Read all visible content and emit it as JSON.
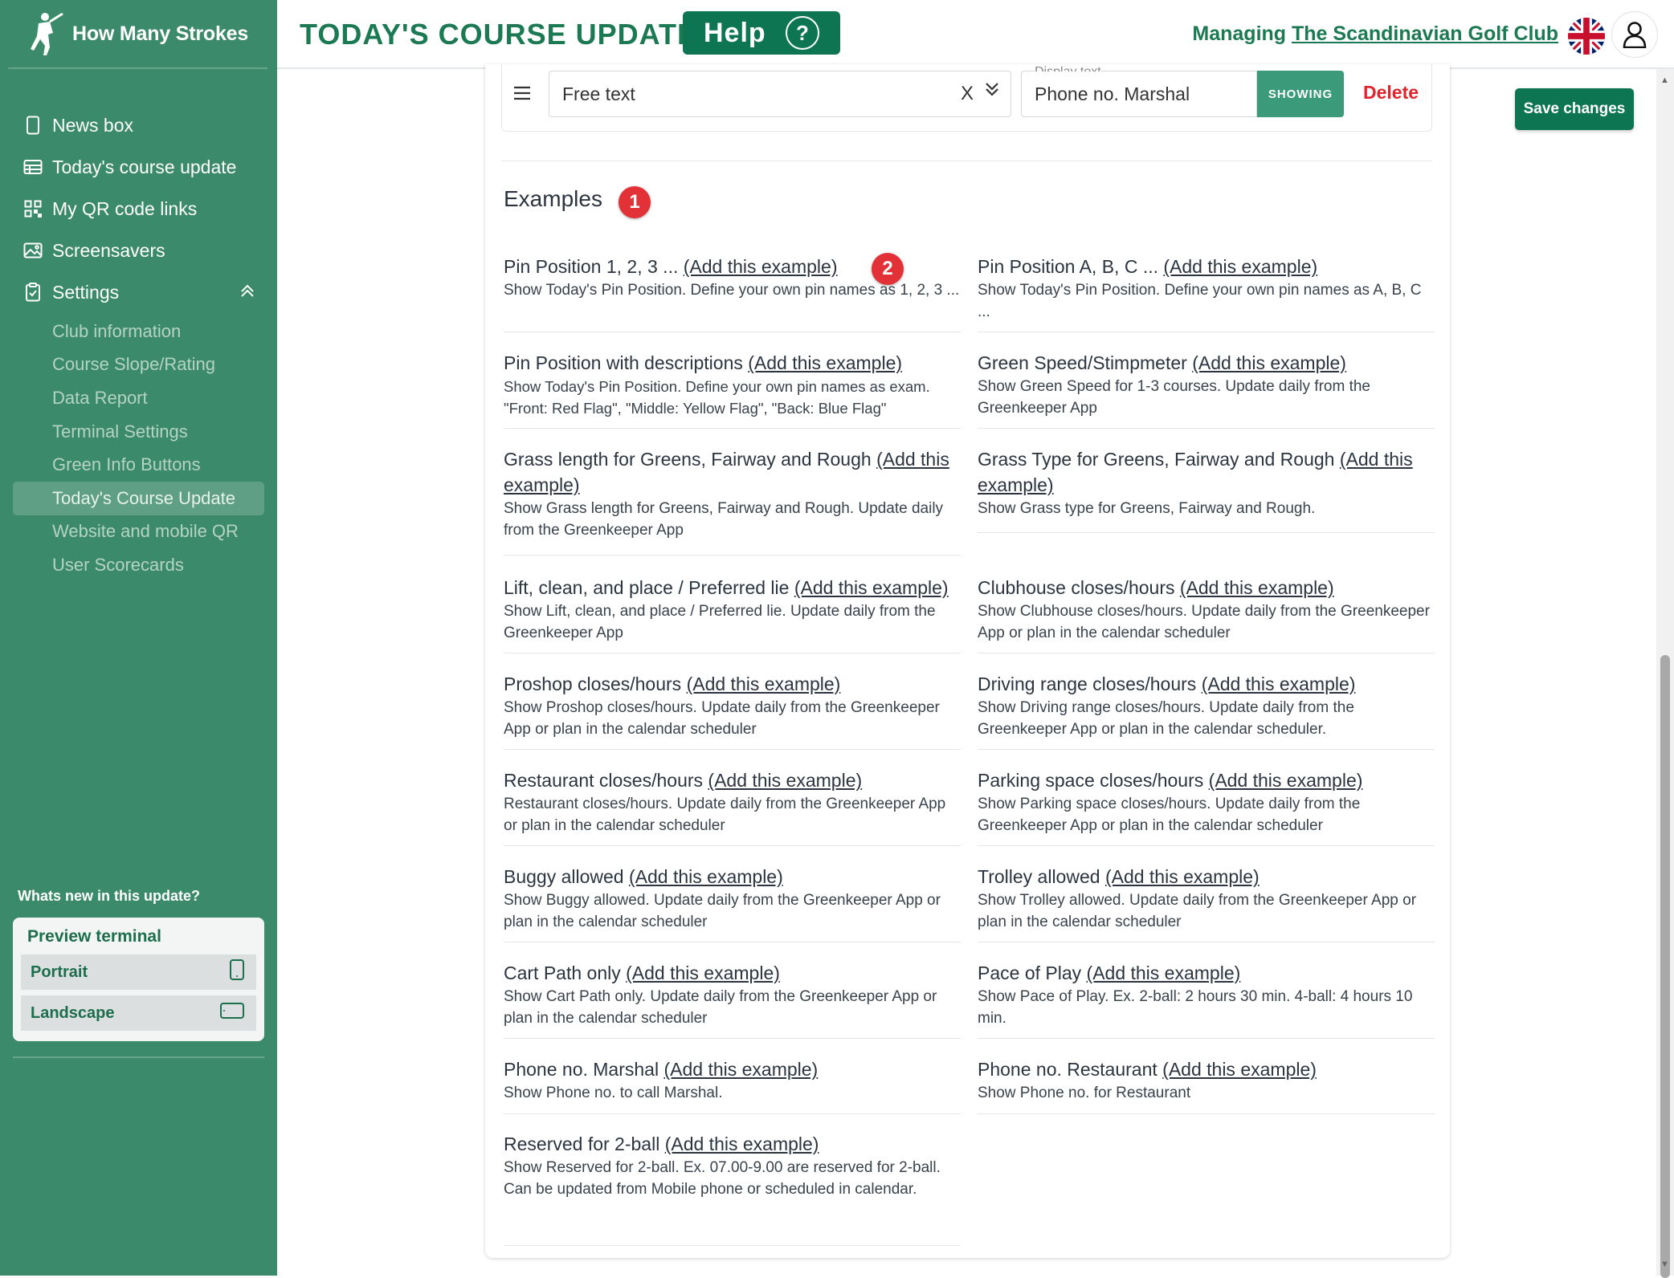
{
  "app": {
    "name": "How Many Strokes",
    "page_title": "TODAY'S COURSE UPDATE",
    "help_label": "Help",
    "help_icon": "?",
    "managing_prefix": "Managing",
    "club_name": "The Scandinavian Golf Club",
    "save_label": "Save changes"
  },
  "sidebar": {
    "nav": [
      {
        "label": "News box",
        "icon": "tablet-icon"
      },
      {
        "label": "Today's course update",
        "icon": "table-icon"
      },
      {
        "label": "My QR code links",
        "icon": "qr-icon"
      },
      {
        "label": "Screensavers",
        "icon": "image-icon"
      },
      {
        "label": "Settings",
        "icon": "clipboard-icon"
      }
    ],
    "settings_sub": [
      "Club information",
      "Course Slope/Rating",
      "Data Report",
      "Terminal Settings",
      "Green Info Buttons",
      "Today's Course Update",
      "Website and mobile QR",
      "User Scorecards"
    ],
    "active_sub": "Today's Course Update",
    "whats_new": "Whats new in this update?",
    "preview": {
      "title": "Preview terminal",
      "portrait": "Portrait",
      "landscape": "Landscape"
    }
  },
  "field_row": {
    "select_value": "Free text",
    "clear": "X",
    "display_label": "Display text",
    "display_value": "Phone no. Marshal",
    "showing": "SHOWING",
    "delete": "Delete"
  },
  "examples": {
    "title": "Examples",
    "badge1": "1",
    "badge2": "2",
    "add_label": "(Add this example)",
    "items": [
      {
        "title": "Pin Position 1, 2, 3 ...",
        "desc": "Show Today's Pin Position. Define your own pin names as 1, 2, 3 ..."
      },
      {
        "title": "Pin Position A, B, C ...",
        "desc": "Show Today's Pin Position. Define your own pin names as A, B, C ..."
      },
      {
        "title": "Pin Position with descriptions",
        "desc": "Show Today's Pin Position. Define your own pin names as exam. \"Front: Red Flag\", \"Middle: Yellow Flag\", \"Back: Blue Flag\""
      },
      {
        "title": "Green Speed/Stimpmeter",
        "desc": "Show Green Speed for 1-3 courses. Update daily from the Greenkeeper App"
      },
      {
        "title": "Grass length for Greens, Fairway and Rough",
        "desc": "Show Grass length for Greens, Fairway and Rough. Update daily from the Greenkeeper App"
      },
      {
        "title": "Grass Type for Greens, Fairway and Rough",
        "desc": "Show Grass type for Greens, Fairway and Rough."
      },
      {
        "title": "Lift, clean, and place / Preferred lie",
        "desc": "Show Lift, clean, and place / Preferred lie. Update daily from the Greenkeeper App"
      },
      {
        "title": "Clubhouse closes/hours",
        "desc": "Show Clubhouse closes/hours. Update daily from the Greenkeeper App or plan in the calendar scheduler"
      },
      {
        "title": "Proshop closes/hours",
        "desc": "Show Proshop closes/hours. Update daily from the Greenkeeper App or plan in the calendar scheduler"
      },
      {
        "title": "Driving range closes/hours",
        "desc": "Show Driving range closes/hours. Update daily from the Greenkeeper App or plan in the calendar scheduler."
      },
      {
        "title": "Restaurant closes/hours",
        "desc": "Restaurant closes/hours. Update daily from the Greenkeeper App or plan in the calendar scheduler"
      },
      {
        "title": "Parking space closes/hours",
        "desc": "Show Parking space closes/hours. Update daily from the Greenkeeper App or plan in the calendar scheduler"
      },
      {
        "title": "Buggy allowed",
        "desc": "Show Buggy allowed. Update daily from the Greenkeeper App or plan in the calendar scheduler"
      },
      {
        "title": "Trolley allowed",
        "desc": "Show Trolley allowed. Update daily from the Greenkeeper App or plan in the calendar scheduler"
      },
      {
        "title": "Cart Path only",
        "desc": "Show Cart Path only. Update daily from the Greenkeeper App or plan in the calendar scheduler"
      },
      {
        "title": "Pace of Play",
        "desc": "Show Pace of Play. Ex. 2-ball: 2 hours 30 min. 4-ball: 4 hours 10 min."
      },
      {
        "title": "Phone no. Marshal",
        "desc": "Show Phone no. to call Marshal."
      },
      {
        "title": "Phone no. Restaurant",
        "desc": "Show Phone no. for Restaurant"
      },
      {
        "title": "Reserved for 2-ball",
        "desc": "Show Reserved for 2-ball. Ex. 07.00-9.00 are reserved for 2-ball. Can be updated from Mobile phone or scheduled in calendar."
      }
    ]
  },
  "colors": {
    "sidebar_bg": "#3b8a6b",
    "brand_green": "#0e7552",
    "title_green": "#1b7a53",
    "delete_red": "#e0222d",
    "badge_red": "#e23238"
  }
}
